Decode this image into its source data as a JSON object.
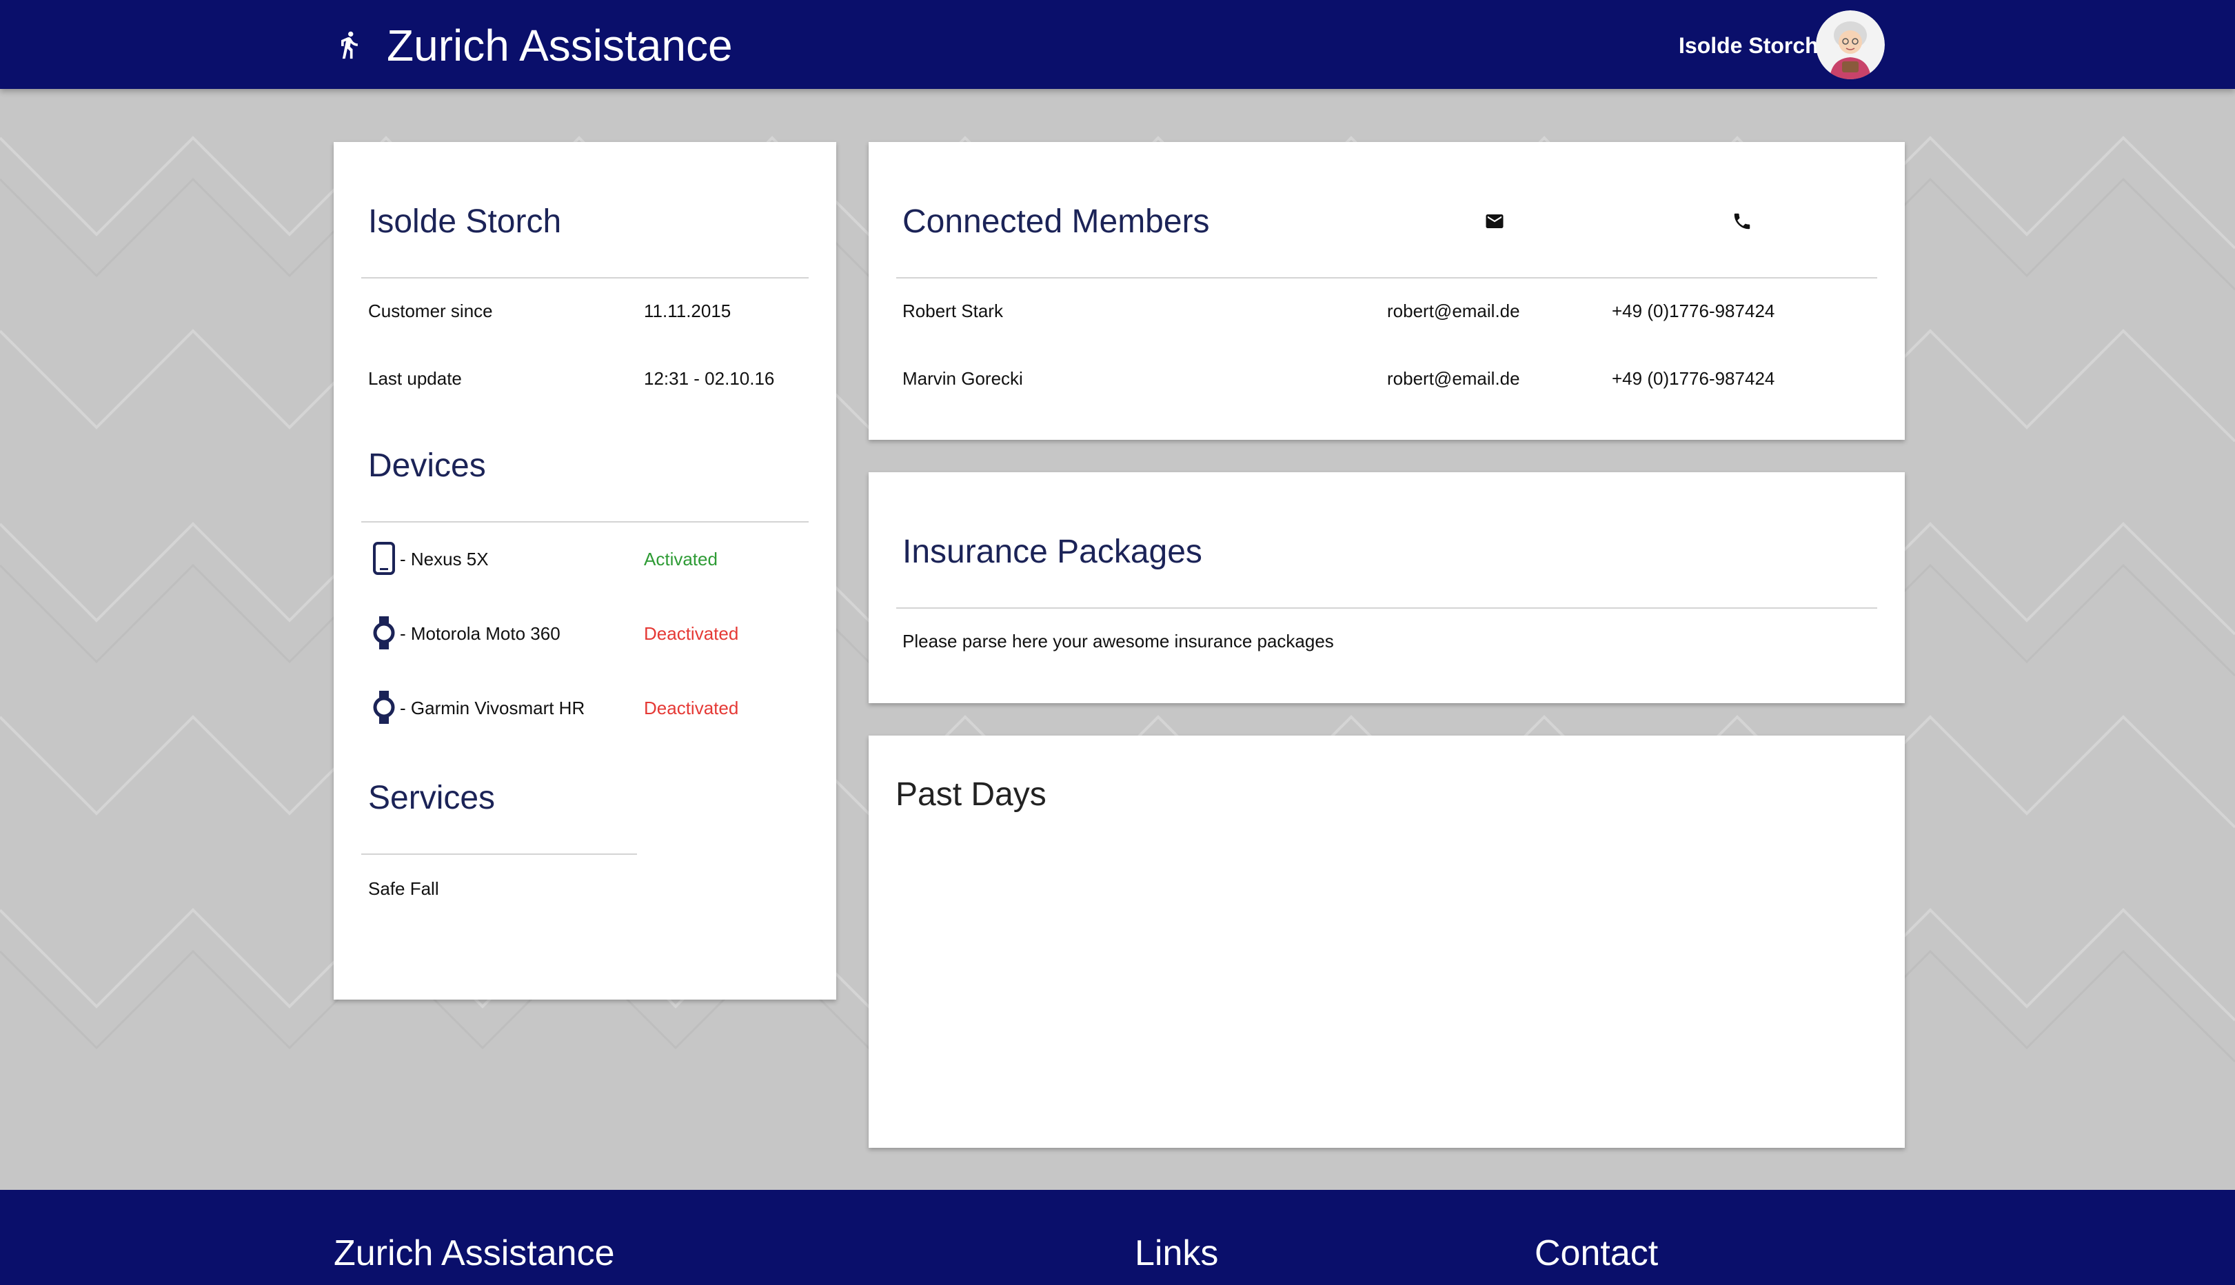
{
  "header": {
    "app_title": "Zurich Assistance",
    "user_name": "Isolde Storch",
    "runner_icon": "directions-run-icon",
    "avatar_icon": "avatar-grandma"
  },
  "profile": {
    "name": "Isolde Storch",
    "rows": [
      {
        "label": "Customer since",
        "value": "11.11.2015"
      },
      {
        "label": "Last update",
        "value": "12:31 - 02.10.16"
      }
    ],
    "devices_title": "Devices",
    "devices": [
      {
        "icon": "smartphone-icon",
        "name": "- Nexus 5X",
        "status": "Activated",
        "status_kind": "ok"
      },
      {
        "icon": "smartwatch-icon",
        "name": "- Motorola Moto 360",
        "status": "Deactivated",
        "status_kind": "bad"
      },
      {
        "icon": "smartwatch-icon",
        "name": "- Garmin Vivosmart HR",
        "status": "Deactivated",
        "status_kind": "bad"
      }
    ],
    "services_title": "Services",
    "services": [
      "Safe Fall"
    ]
  },
  "members": {
    "title": "Connected Members",
    "email_icon": "email-icon",
    "phone_icon": "phone-icon",
    "rows": [
      {
        "name": "Robert Stark",
        "email": "robert@email.de",
        "phone": "+49 (0)1776-987424"
      },
      {
        "name": "Marvin Gorecki",
        "email": "robert@email.de",
        "phone": "+49 (0)1776-987424"
      }
    ]
  },
  "insurance": {
    "title": "Insurance Packages",
    "text": "Please parse here your awesome insurance packages"
  },
  "past_days": {
    "title": "Past Days"
  },
  "footer": {
    "col1": "Zurich Assistance",
    "col2": "Links",
    "col3": "Contact"
  },
  "colors": {
    "brand": "#0a0f6b",
    "activated": "#2e9b35",
    "deactivated": "#e53935",
    "title_text": "#1b2357"
  }
}
